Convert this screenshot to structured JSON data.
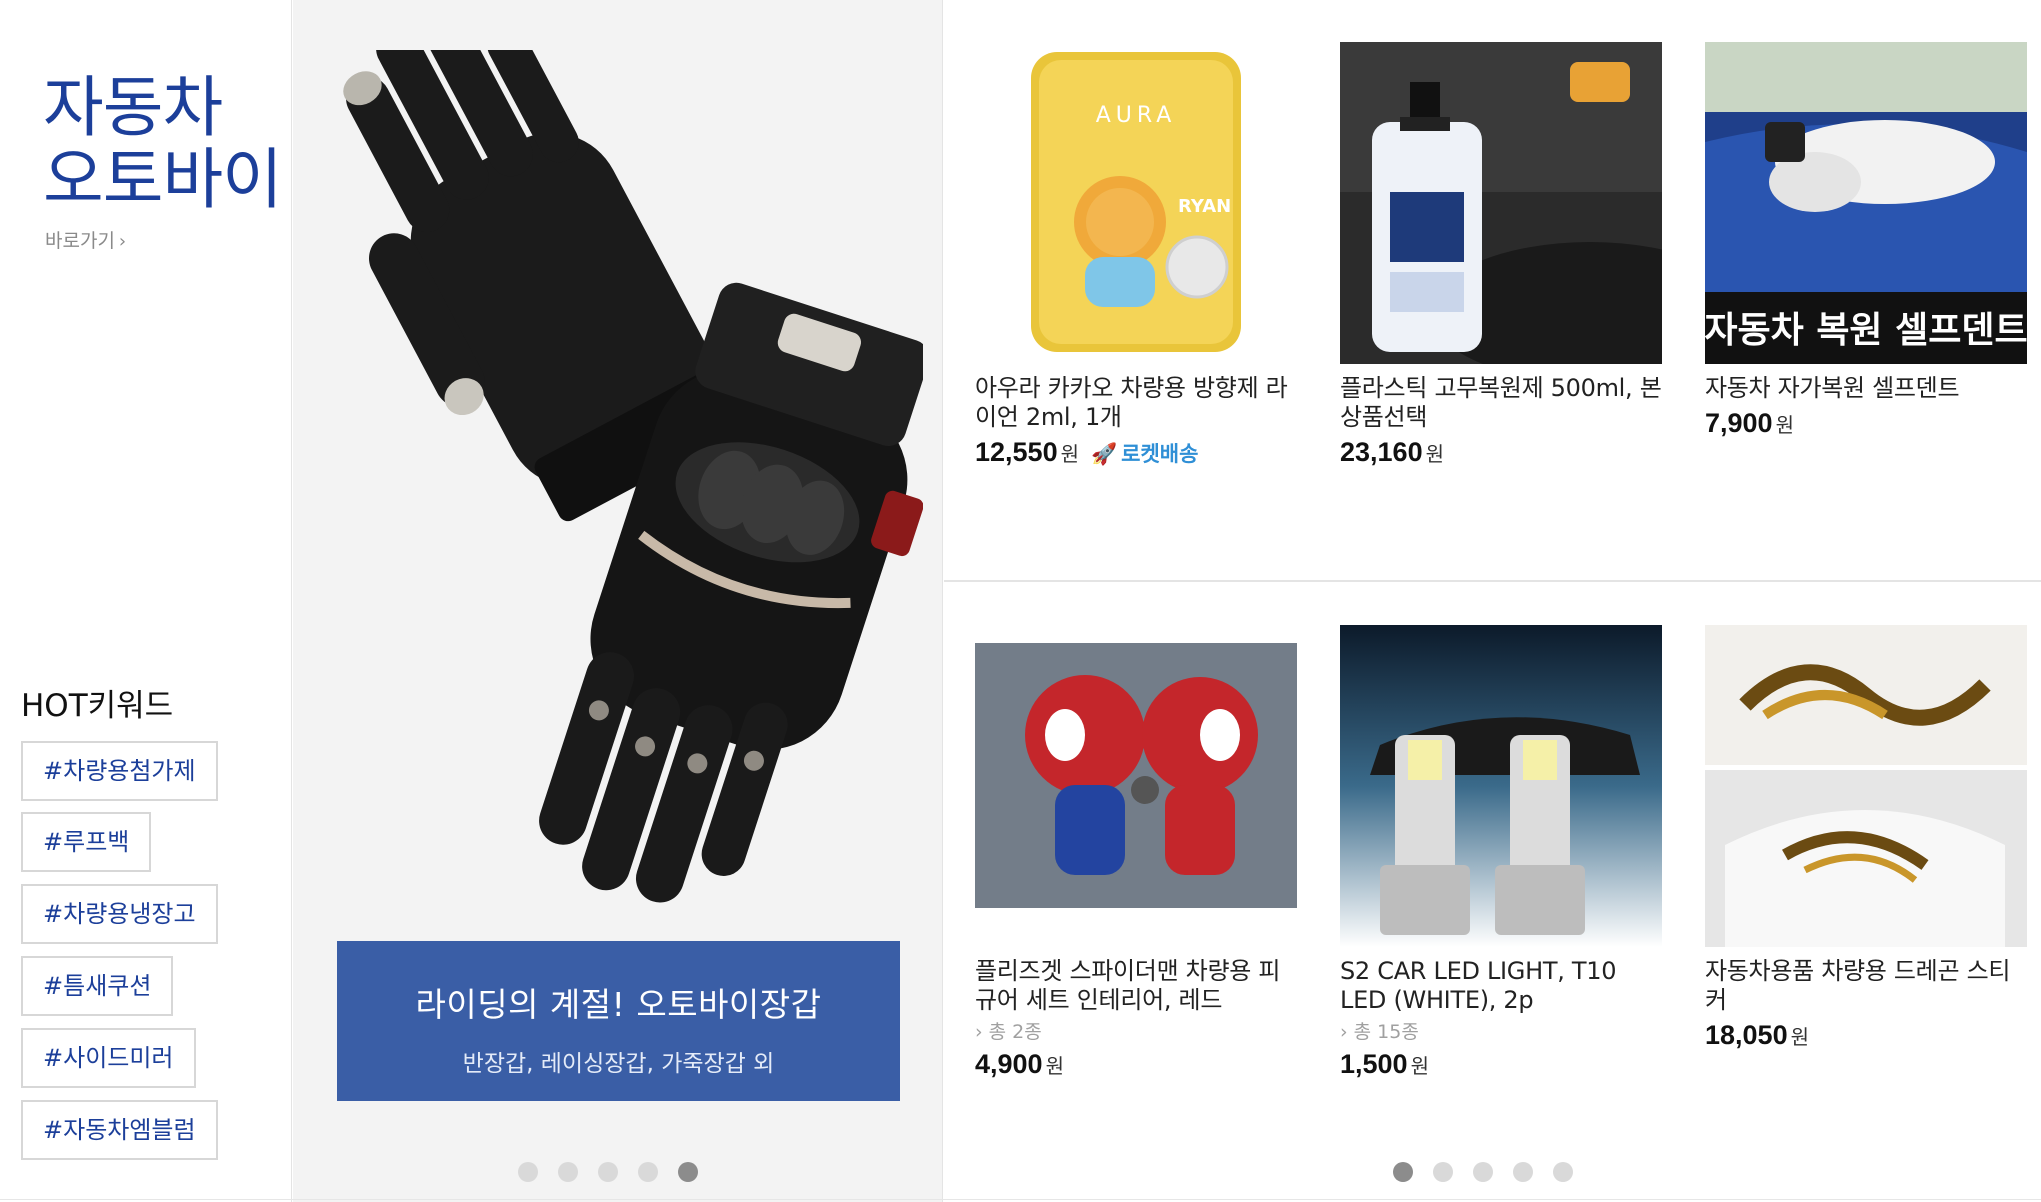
{
  "category": {
    "title_line1": "자동차",
    "title_line2": "오토바이",
    "shortcut_label": "바로가기",
    "shortcut_icon": "chevron-right-icon"
  },
  "hot_keywords": {
    "title": "HOT키워드",
    "items": [
      "#차량용첨가제",
      "#루프백",
      "#차량용냉장고",
      "#틈새쿠션",
      "#사이드미러",
      "#자동차엠블럼"
    ]
  },
  "banner": {
    "title": "라이딩의 계절! 오토바이장갑",
    "subtitle": "반장갑, 레이싱장갑, 가죽장갑 외",
    "image": "motorcycle-gloves",
    "slide_count": 5,
    "active_slide": 5
  },
  "products": [
    {
      "name": "아우라 카카오 차량용 방향제 라이언 2ml, 1개",
      "variants": "",
      "price": "12,550",
      "unit": "원",
      "badge": "로켓배송",
      "image": "ryan-air-freshener",
      "thumb_text": "AURA"
    },
    {
      "name": "플라스틱 고무복원제 500ml, 본상품선택",
      "variants": "",
      "price": "23,160",
      "unit": "원",
      "badge": "",
      "image": "plastic-restorer-bottle",
      "thumb_text": ""
    },
    {
      "name": "자동차 자가복원 셀프덴트",
      "variants": "",
      "price": "7,900",
      "unit": "원",
      "badge": "",
      "image": "self-dent-puller",
      "thumb_text": "자동차 복원 셀프덴트"
    },
    {
      "name": "플리즈겟 스파이더맨 차량용 피규어 세트 인테리어, 레드",
      "variants": "총 2종",
      "price": "4,900",
      "unit": "원",
      "badge": "",
      "image": "spiderman-figure",
      "thumb_text": ""
    },
    {
      "name": "S2 CAR LED LIGHT, T10 LED (WHITE), 2p",
      "variants": "총 15종",
      "price": "1,500",
      "unit": "원",
      "badge": "",
      "image": "led-headlight-bulbs",
      "thumb_text": ""
    },
    {
      "name": "자동차용품 차량용 드레곤 스티커",
      "variants": "",
      "price": "18,050",
      "unit": "원",
      "badge": "",
      "image": "dragon-sticker",
      "thumb_text": ""
    }
  ],
  "product_pager": {
    "slide_count": 5,
    "active_slide": 1
  },
  "colors": {
    "brand_blue": "#1c3f9a",
    "banner_blue": "#3a5ea6",
    "rocket_blue": "#2f8fd6"
  }
}
